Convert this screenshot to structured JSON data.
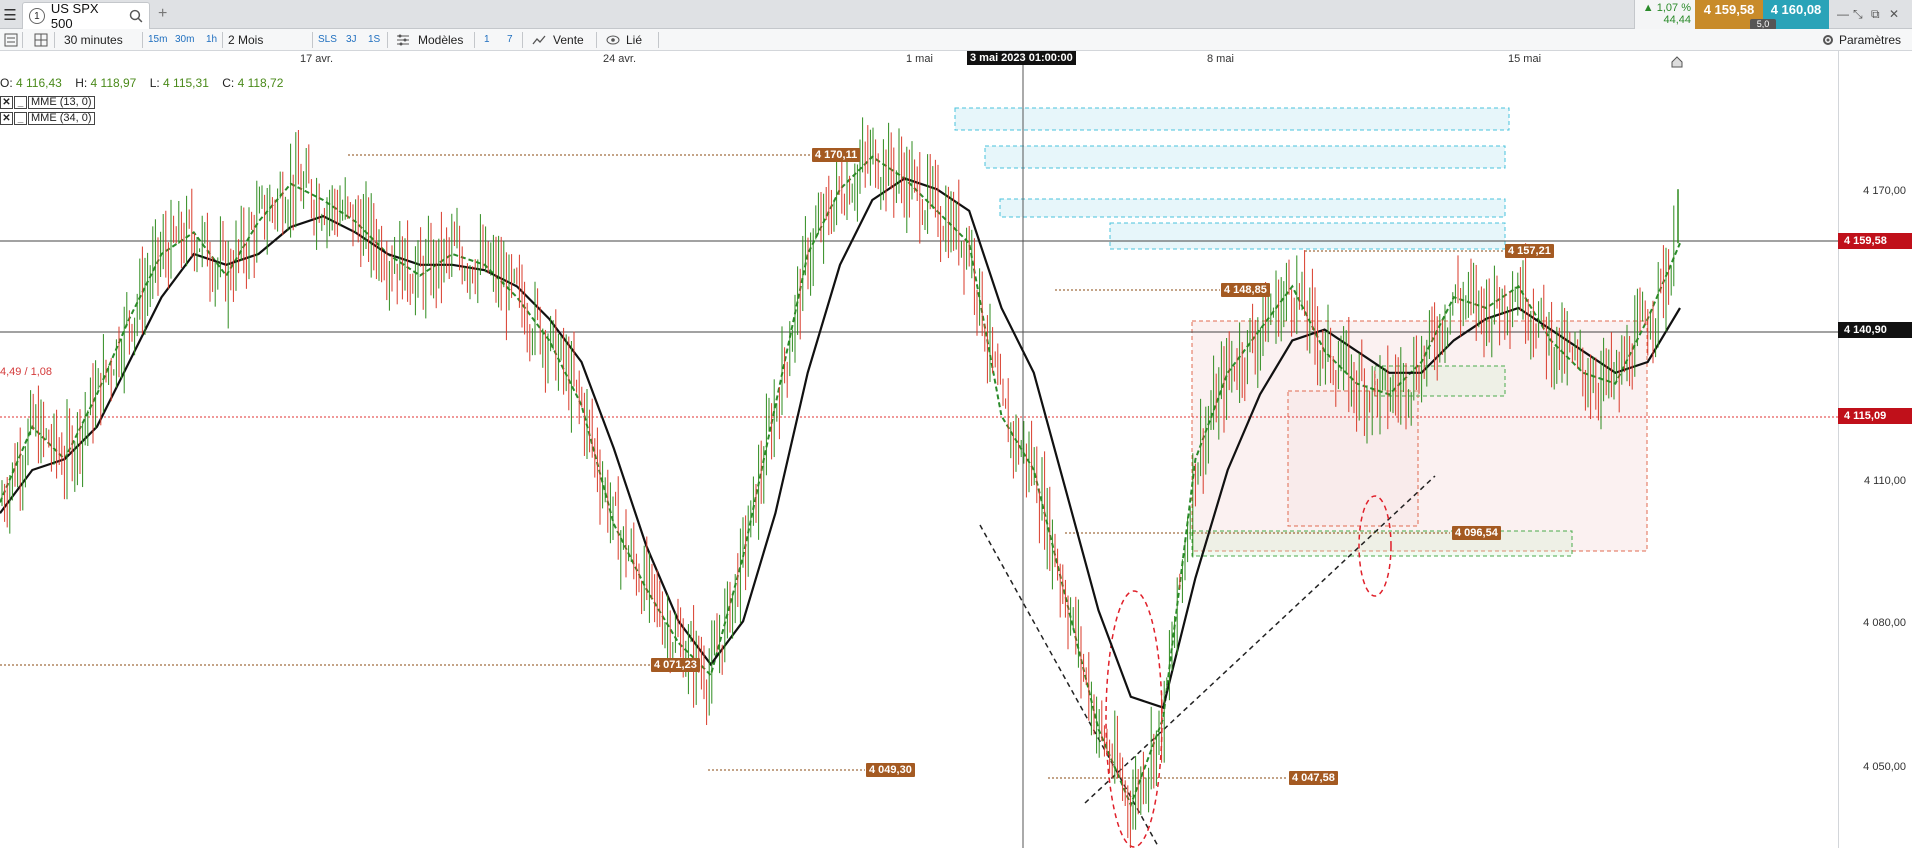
{
  "tab": {
    "number": "1",
    "title": "US SPX 500"
  },
  "quote": {
    "change_pct": "▲ 1,07 %",
    "change_abs": "44,44",
    "bid": "4 159,58",
    "ask": "4 160,08",
    "spread": "5,0"
  },
  "toolbar": {
    "interval": "30 minutes",
    "intervals": [
      "15m",
      "30m",
      "1h"
    ],
    "range": "2 Mois",
    "periods": [
      "SLS",
      "3J",
      "1S"
    ],
    "models": "Modèles",
    "days": [
      "1",
      "7"
    ],
    "sell": "Vente",
    "linked": "Lié",
    "settings": "Paramètres"
  },
  "x_labels": [
    "17 avr.",
    "24 avr.",
    "1 mai",
    "8 mai",
    "15 mai"
  ],
  "crosshair_date": "3 mai 2023 01:00:00",
  "ohlc": {
    "o": "4 116,43",
    "h": "4 118,97",
    "l": "4 115,31",
    "c": "4 118,72"
  },
  "indicators": [
    {
      "check": "✕",
      "line": "_",
      "label": "MME (13, 0)"
    },
    {
      "check": "✕",
      "line": "_",
      "label": "MME (34, 0)"
    }
  ],
  "price_axis": [
    "4 170,00",
    "4 110,00",
    "4 080,00",
    "4 050,00"
  ],
  "price_tags": {
    "current": "4 159,58",
    "line2": "4 140,90",
    "line3": "4 115,09"
  },
  "levels": [
    "4 170,11",
    "4 157,21",
    "4 148,85",
    "4 096,54",
    "4 071,23",
    "4 049,30",
    "4 047,58"
  ],
  "side_label": "4,49 / 1,08",
  "colors": {
    "up": "#2e8b1e",
    "down": "#d93a2a",
    "ema13": "#2a8a2a",
    "ema34": "#111111",
    "level": "#a45a22",
    "current": "#c0101a"
  },
  "chart_data": {
    "type": "line",
    "series": [
      {
        "name": "MME (13, 0)",
        "values": [
          4104,
          4118,
          4112,
          4124,
          4138,
          4150,
          4154,
          4146,
          4156,
          4163,
          4160,
          4156,
          4150,
          4146,
          4150,
          4148,
          4142,
          4134,
          4122,
          4100,
          4088,
          4078,
          4072,
          4094,
          4122,
          4150,
          4162,
          4168,
          4164,
          4158,
          4152,
          4120,
          4110,
          4086,
          4062,
          4048,
          4064,
          4112,
          4128,
          4136,
          4144,
          4132,
          4126,
          4124,
          4130,
          4142,
          4140,
          4144,
          4134,
          4128,
          4126,
          4138,
          4152
        ]
      },
      {
        "name": "MME (34, 0)",
        "values": [
          4102,
          4110,
          4112,
          4118,
          4130,
          4142,
          4150,
          4148,
          4150,
          4155,
          4157,
          4154,
          4150,
          4148,
          4148,
          4147,
          4144,
          4138,
          4130,
          4114,
          4096,
          4082,
          4074,
          4082,
          4102,
          4128,
          4148,
          4160,
          4164,
          4162,
          4158,
          4140,
          4128,
          4106,
          4084,
          4068,
          4066,
          4090,
          4110,
          4124,
          4134,
          4136,
          4132,
          4128,
          4128,
          4134,
          4138,
          4140,
          4136,
          4132,
          4128,
          4130,
          4140
        ]
      }
    ],
    "ylim": [
      4040,
      4185
    ]
  }
}
